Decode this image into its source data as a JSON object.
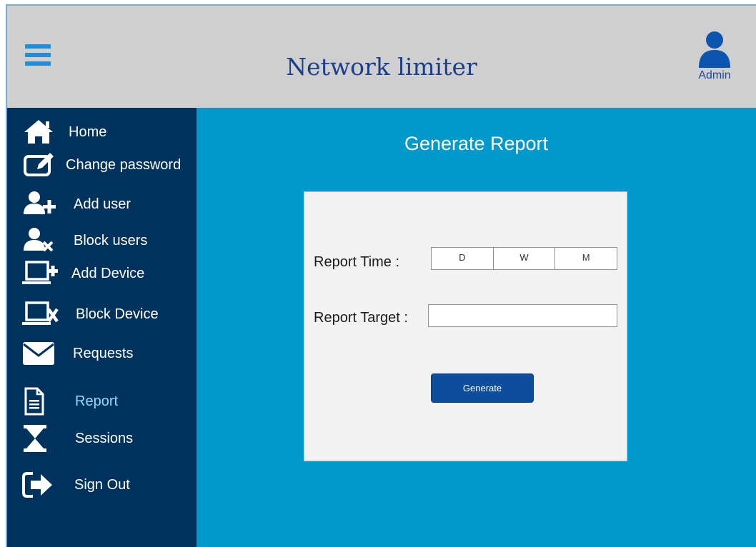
{
  "app": {
    "title": "Network limiter",
    "user_label": "Admin"
  },
  "sidebar": {
    "items": [
      {
        "label": "Home",
        "icon": "home-icon"
      },
      {
        "label": "Change password",
        "icon": "edit-icon"
      },
      {
        "label": "Add user",
        "icon": "user-add-icon"
      },
      {
        "label": "Block users",
        "icon": "user-block-icon"
      },
      {
        "label": "Add Device",
        "icon": "laptop-add-icon"
      },
      {
        "label": "Block Device",
        "icon": "laptop-block-icon"
      },
      {
        "label": "Requests",
        "icon": "envelope-icon"
      },
      {
        "label": "Report",
        "icon": "document-icon",
        "active": true
      },
      {
        "label": "Sessions",
        "icon": "hourglass-icon"
      },
      {
        "label": "Sign Out",
        "icon": "sign-out-icon"
      }
    ]
  },
  "main": {
    "title": "Generate Report",
    "form": {
      "time_label": "Report Time :",
      "time_options": [
        "D",
        "W",
        "M"
      ],
      "target_label": "Report Target :",
      "target_value": "",
      "generate_label": "Generate"
    }
  },
  "colors": {
    "header_bg": "#cfcfcf",
    "sidebar_bg": "#00325e",
    "main_bg": "#0099cc",
    "card_bg": "#f2f2f2",
    "accent": "#0d4d9e",
    "active_nav": "#8fdcff"
  }
}
